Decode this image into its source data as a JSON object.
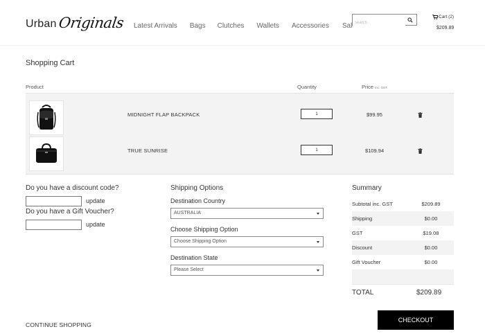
{
  "header": {
    "logo_prefix": "Urban",
    "logo_script": "Originals",
    "nav": [
      "Latest Arrivals",
      "Bags",
      "Clutches",
      "Wallets",
      "Accessories",
      "Sale"
    ],
    "search_placeholder": "search",
    "cart_label": "Cart (2)",
    "cart_total": "$209.89"
  },
  "page": {
    "title": "Shopping Cart"
  },
  "cart": {
    "columns": {
      "product": "Product",
      "quantity": "Quantity",
      "price": "Price",
      "price_note": "inc. GST"
    },
    "items": [
      {
        "name": "MIDNIGHT FLAP BACKPACK",
        "quantity": "1",
        "price": "$99.95"
      },
      {
        "name": "TRUE SUNRISE",
        "quantity": "1",
        "price": "$109.94"
      }
    ]
  },
  "discount": {
    "question": "Do you have a discount code?",
    "update": "update"
  },
  "voucher": {
    "question": "Do you have a Gift Voucher?",
    "update": "update"
  },
  "shipping": {
    "title": "Shipping Options",
    "country_label": "Destination Country",
    "country_value": "AUSTRALIA",
    "option_label": "Choose Shipping Option",
    "option_value": "Choose Shipping Option",
    "state_label": "Destination State",
    "state_value": "Please Select"
  },
  "summary": {
    "title": "Summary",
    "rows": [
      {
        "label": "Subtotal inc. GST",
        "value": "$209.89"
      },
      {
        "label": "Shipping",
        "value": "$0.00"
      },
      {
        "label": "GST",
        "value": "$19.08"
      },
      {
        "label": "Discount",
        "value": "$0.00"
      },
      {
        "label": "Gift Voucher",
        "value": "$0.00"
      }
    ],
    "total_label": "TOTAL",
    "total_value": "$209.89"
  },
  "actions": {
    "continue": "CONTINUE SHOPPING",
    "checkout": "CHECKOUT"
  }
}
